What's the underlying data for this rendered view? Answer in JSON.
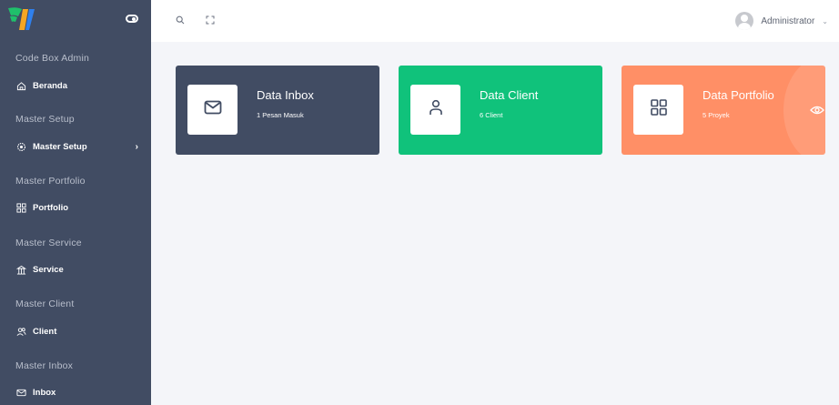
{
  "sidebar": {
    "app_title": "Code Box Admin",
    "items": [
      {
        "section": "",
        "label": "Beranda",
        "icon": "home-icon"
      },
      {
        "section": "Master Setup",
        "label": "Master Setup",
        "icon": "gear-icon",
        "has_submenu": true
      },
      {
        "section": "Master Portfolio",
        "label": "Portfolio",
        "icon": "grid-icon"
      },
      {
        "section": "Master Service",
        "label": "Service",
        "icon": "building-icon"
      },
      {
        "section": "Master Client",
        "label": "Client",
        "icon": "users-icon"
      },
      {
        "section": "Master Inbox",
        "label": "Inbox",
        "icon": "mail-icon"
      }
    ]
  },
  "topbar": {
    "search_icon": "search-icon",
    "fullscreen_icon": "fullscreen-icon",
    "user_name": "Administrator"
  },
  "cards": [
    {
      "title": "Data Inbox",
      "subtitle": "1 Pesan Masuk",
      "icon": "mail-icon",
      "color": "#414c63"
    },
    {
      "title": "Data Client",
      "subtitle": "6 Client",
      "icon": "user-icon",
      "color": "#10c27b"
    },
    {
      "title": "Data Portfolio",
      "subtitle": "5 Proyek",
      "icon": "grid-icon",
      "color": "#ff8f66"
    }
  ],
  "colors": {
    "sidebar_bg": "#414c63",
    "page_bg": "#f4f5f9"
  }
}
